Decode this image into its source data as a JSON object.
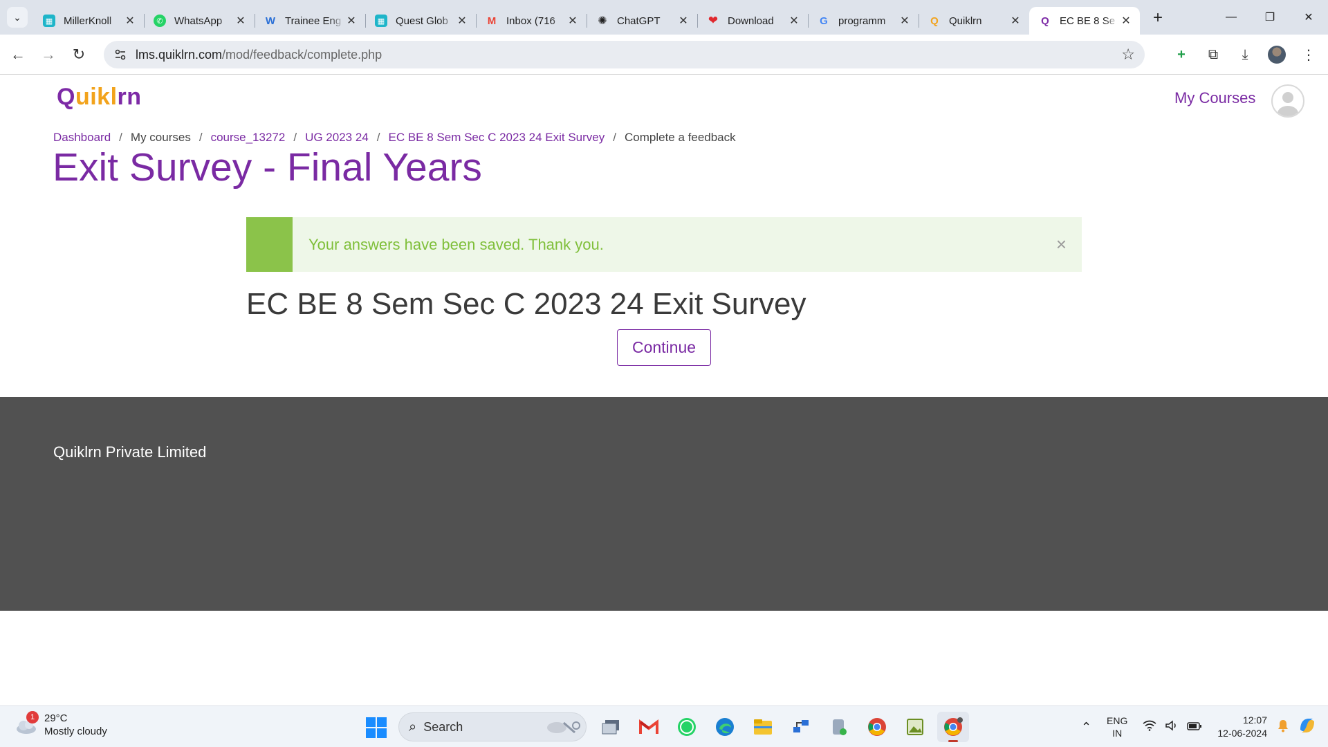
{
  "browser": {
    "tabs": [
      {
        "title": "MillerKnoll",
        "icon": "millerknoll-icon",
        "color": "#1fb5c9",
        "active": false
      },
      {
        "title": "WhatsApp",
        "icon": "whatsapp-icon",
        "color": "#25d366",
        "active": false
      },
      {
        "title": "Trainee Eng",
        "icon": "w-icon",
        "color": "#2a6fd6",
        "active": false
      },
      {
        "title": "Quest Glob",
        "icon": "quest-icon",
        "color": "#1fb5c9",
        "active": false
      },
      {
        "title": "Inbox (716",
        "icon": "gmail-icon",
        "color": "#ea4335",
        "active": false
      },
      {
        "title": "ChatGPT",
        "icon": "chatgpt-icon",
        "color": "#222222",
        "active": false
      },
      {
        "title": "Download",
        "icon": "heart-icon",
        "color": "#e0282e",
        "active": false
      },
      {
        "title": "programm",
        "icon": "google-icon",
        "color": "#4285f4",
        "active": false
      },
      {
        "title": "Quiklrn",
        "icon": "quiklrn-icon",
        "color": "#f2a31c",
        "active": false
      },
      {
        "title": "EC BE 8 Se",
        "icon": "quiklrn-icon",
        "color": "#7d2aa6",
        "active": true
      }
    ],
    "url_host": "lms.quiklrn.com",
    "url_path": "/mod/feedback/complete.php"
  },
  "site": {
    "logo": {
      "q": "Q",
      "mid": "uikl",
      "end": "rn"
    },
    "my_courses": "My Courses"
  },
  "breadcrumb": [
    {
      "label": "Dashboard",
      "link": true
    },
    {
      "label": "My courses",
      "link": false
    },
    {
      "label": "course_13272",
      "link": true
    },
    {
      "label": "UG 2023 24",
      "link": true
    },
    {
      "label": "EC BE 8 Sem Sec C 2023 24 Exit Survey",
      "link": true
    },
    {
      "label": "Complete a feedback",
      "link": false
    }
  ],
  "page_title": "Exit Survey - Final Years",
  "alert": {
    "message": "Your answers have been saved. Thank you.",
    "close": "×"
  },
  "survey_title": "EC BE 8 Sem Sec C 2023 24 Exit Survey",
  "continue_label": "Continue",
  "footer_text": "Quiklrn Private Limited",
  "taskbar": {
    "weather_temp": "29°C",
    "weather_desc": "Mostly cloudy",
    "weather_badge": "1",
    "search_placeholder": "Search",
    "lang_top": "ENG",
    "lang_bottom": "IN",
    "time": "12:07",
    "date": "12-06-2024"
  },
  "colors": {
    "accent": "#7a2aa3",
    "success_bar": "#8bc34a",
    "success_text": "#7fbf3a",
    "footer": "#515151"
  }
}
